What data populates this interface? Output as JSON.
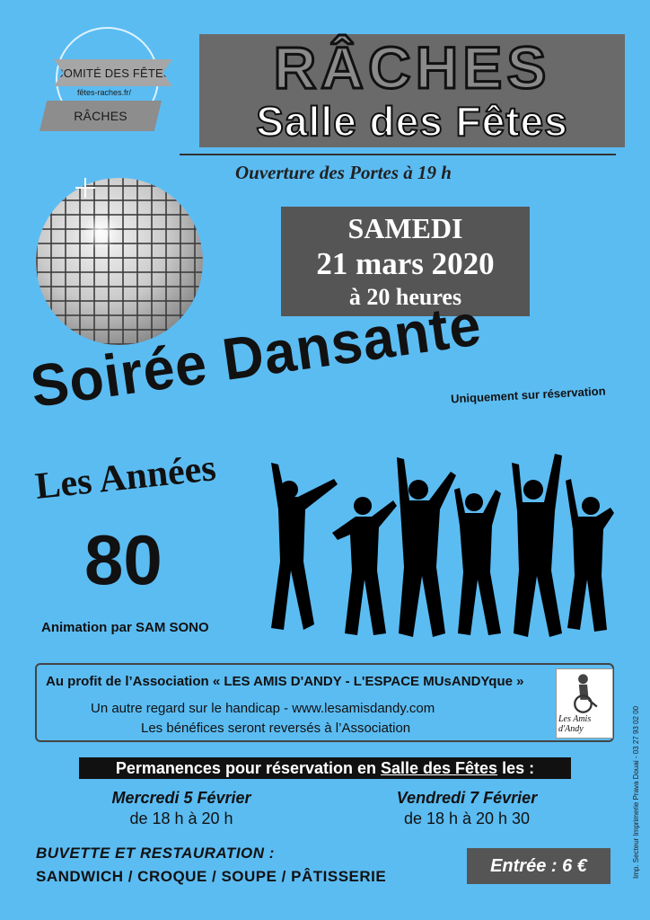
{
  "logo": {
    "name": "COMITÉ DES FÊTES",
    "url": "fêtes-raches.fr/",
    "town": "RÂCHES"
  },
  "header": {
    "title": "RÂCHES",
    "subtitle": "Salle des Fêtes",
    "doors": "Ouverture des Portes à 19 h"
  },
  "date": {
    "day": "SAMEDI",
    "date": "21 mars 2020",
    "time": "à 20 heures"
  },
  "event": {
    "title": "Soirée Dansante",
    "reservation": "Uniquement sur réservation",
    "theme_line1": "Les Années",
    "theme_line2": "80",
    "animation": "Animation par SAM SONO"
  },
  "association": {
    "line1": "Au profit de l’Association « LES AMIS D'ANDY - L'ESPACE MUsANDYque »",
    "line2": "Un autre regard sur le handicap - www.lesamisdandy.com",
    "line3": "Les bénéfices seront reversés à l’Association",
    "logo_text": "Les Amis d'Andy"
  },
  "permanences": {
    "prefix": "Permanences pour réservation en",
    "salle": "Salle des Fêtes",
    "suffix": "les :",
    "slots": [
      {
        "day": "Mercredi 5 Février",
        "hours": "de 18 h à 20 h"
      },
      {
        "day": "Vendredi 7 Février",
        "hours": "de 18 h à 20 h 30"
      }
    ]
  },
  "footer": {
    "buvette": "BUVETTE ET RESTAURATION :",
    "menu": "SANDWICH / CROQUE / SOUPE / PÂTISSERIE",
    "entree": "Entrée : 6 €",
    "printer": "Imp. Secteur Imprimerie Prava Douai - 03 27 93 02 00"
  },
  "colors": {
    "background": "#5bbcf2",
    "box_gray": "#555555",
    "text": "#111111"
  }
}
